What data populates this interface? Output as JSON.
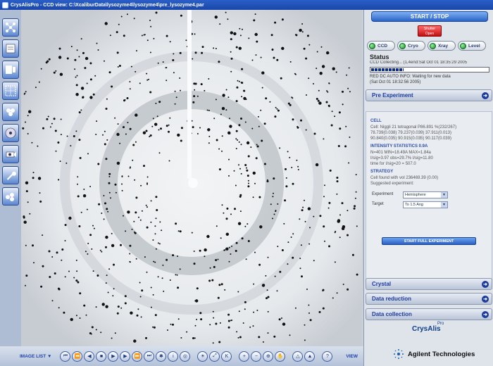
{
  "titlebar": {
    "title": "CrysAlisPro - CCD view: C:\\XcaliburData\\lysozyme4\\lysozyme4\\pre_lysozyme4.par"
  },
  "right_panel": {
    "start_stop": "START / STOP",
    "shutter": {
      "line1": "Shutter",
      "line2": "Open"
    },
    "indicators": [
      {
        "label": "CCD",
        "color": "#18a818"
      },
      {
        "label": "Cryo",
        "color": "#18a818"
      },
      {
        "label": "Xray",
        "color": "#18a818"
      },
      {
        "label": "Level",
        "color": "#18a818"
      }
    ],
    "status": {
      "title": "Status",
      "line": "CCD Collecting... (1,4end:Sat Oct 01 18:35:29 2005",
      "progress": 0.28,
      "info1": "RED DC AUTO INFO: Waiting for new data",
      "info2": "(Sat Oct 01 18:32:56 2005)"
    },
    "pre_experiment": {
      "title": "Pre Experiment",
      "cell_head": "CELL",
      "cell_lines": [
        "Cell: Niggli 21 tetragonal P86.891 %(232/267)",
        "78.739(0.038) 79.237(0.039)  37.911(0.013)",
        "90.840(0.035) 90.915(0.035)  90.117(0.039)"
      ],
      "intensity_head": "INTENSITY STATISTICS 0.9A",
      "intensity_lines": [
        "N=401 MIN=18.49A MAX=1.84a",
        "I/sig=3.97  obs=29.7% I/sig=11.80",
        "time for I/sig=20 = 507.0"
      ],
      "strategy_head": "STRATEGY",
      "strategy_lines": [
        "Cell found with vol 236469.39 (0.00)",
        "Suggested experiment:"
      ],
      "experiment_label": "Experiment",
      "experiment_value": "Hemisphere",
      "target_label": "Target",
      "target_value": "To 1.5 Ang",
      "full_button": "START FULL EXPERIMENT"
    },
    "sections": [
      {
        "label": "Crystal"
      },
      {
        "label": "Data reduction"
      },
      {
        "label": "Data collection"
      }
    ],
    "logo": {
      "crysalis": "CrysAlis",
      "pro": "Pro",
      "agilent": "Agilent Technologies"
    }
  },
  "bottombar": {
    "image_list": "IMAGE LIST ▼",
    "view": "VIEW"
  },
  "left_tools": [
    {
      "icon": "lattice-icon"
    },
    {
      "icon": "document-icon"
    },
    {
      "icon": "image-data-icon"
    },
    {
      "icon": "grid-icon"
    },
    {
      "icon": "molecules-icon"
    },
    {
      "icon": "cd-icon"
    },
    {
      "icon": "camera-icon"
    },
    {
      "icon": "wrench-icon"
    },
    {
      "icon": "molecules2-icon"
    }
  ]
}
